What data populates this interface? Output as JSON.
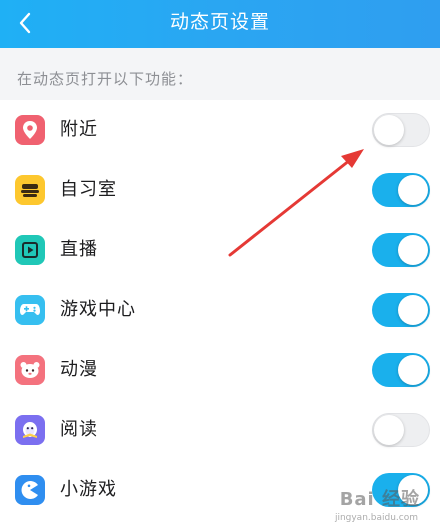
{
  "header": {
    "title": "动态页设置",
    "back_icon": "chevron-left-icon"
  },
  "section_label": "在动态页打开以下功能：",
  "items": [
    {
      "label": "附近",
      "icon": "location-pin-icon",
      "icon_color": "#f06170",
      "enabled": false
    },
    {
      "label": "自习室",
      "icon": "study-room-icon",
      "icon_color": "#fdc72e",
      "enabled": true
    },
    {
      "label": "直播",
      "icon": "live-broadcast-icon",
      "icon_color": "#20c7b7",
      "enabled": true
    },
    {
      "label": "游戏中心",
      "icon": "gamepad-icon",
      "icon_color": "#36bff0",
      "enabled": true
    },
    {
      "label": "动漫",
      "icon": "anime-face-icon",
      "icon_color": "#f4727e",
      "enabled": true
    },
    {
      "label": "阅读",
      "icon": "reading-icon",
      "icon_color": "#7b6ff0",
      "enabled": false
    },
    {
      "label": "小游戏",
      "icon": "mini-game-icon",
      "icon_color": "#2f8ef0",
      "enabled": true
    }
  ],
  "colors": {
    "header": "#2aa6f2",
    "toggle_on": "#1ab0ec",
    "toggle_off": "#eeeff1",
    "annotation_arrow": "#e53935"
  },
  "watermark": {
    "text": "Bai 经验",
    "sub": "jingyan.baidu.com"
  }
}
